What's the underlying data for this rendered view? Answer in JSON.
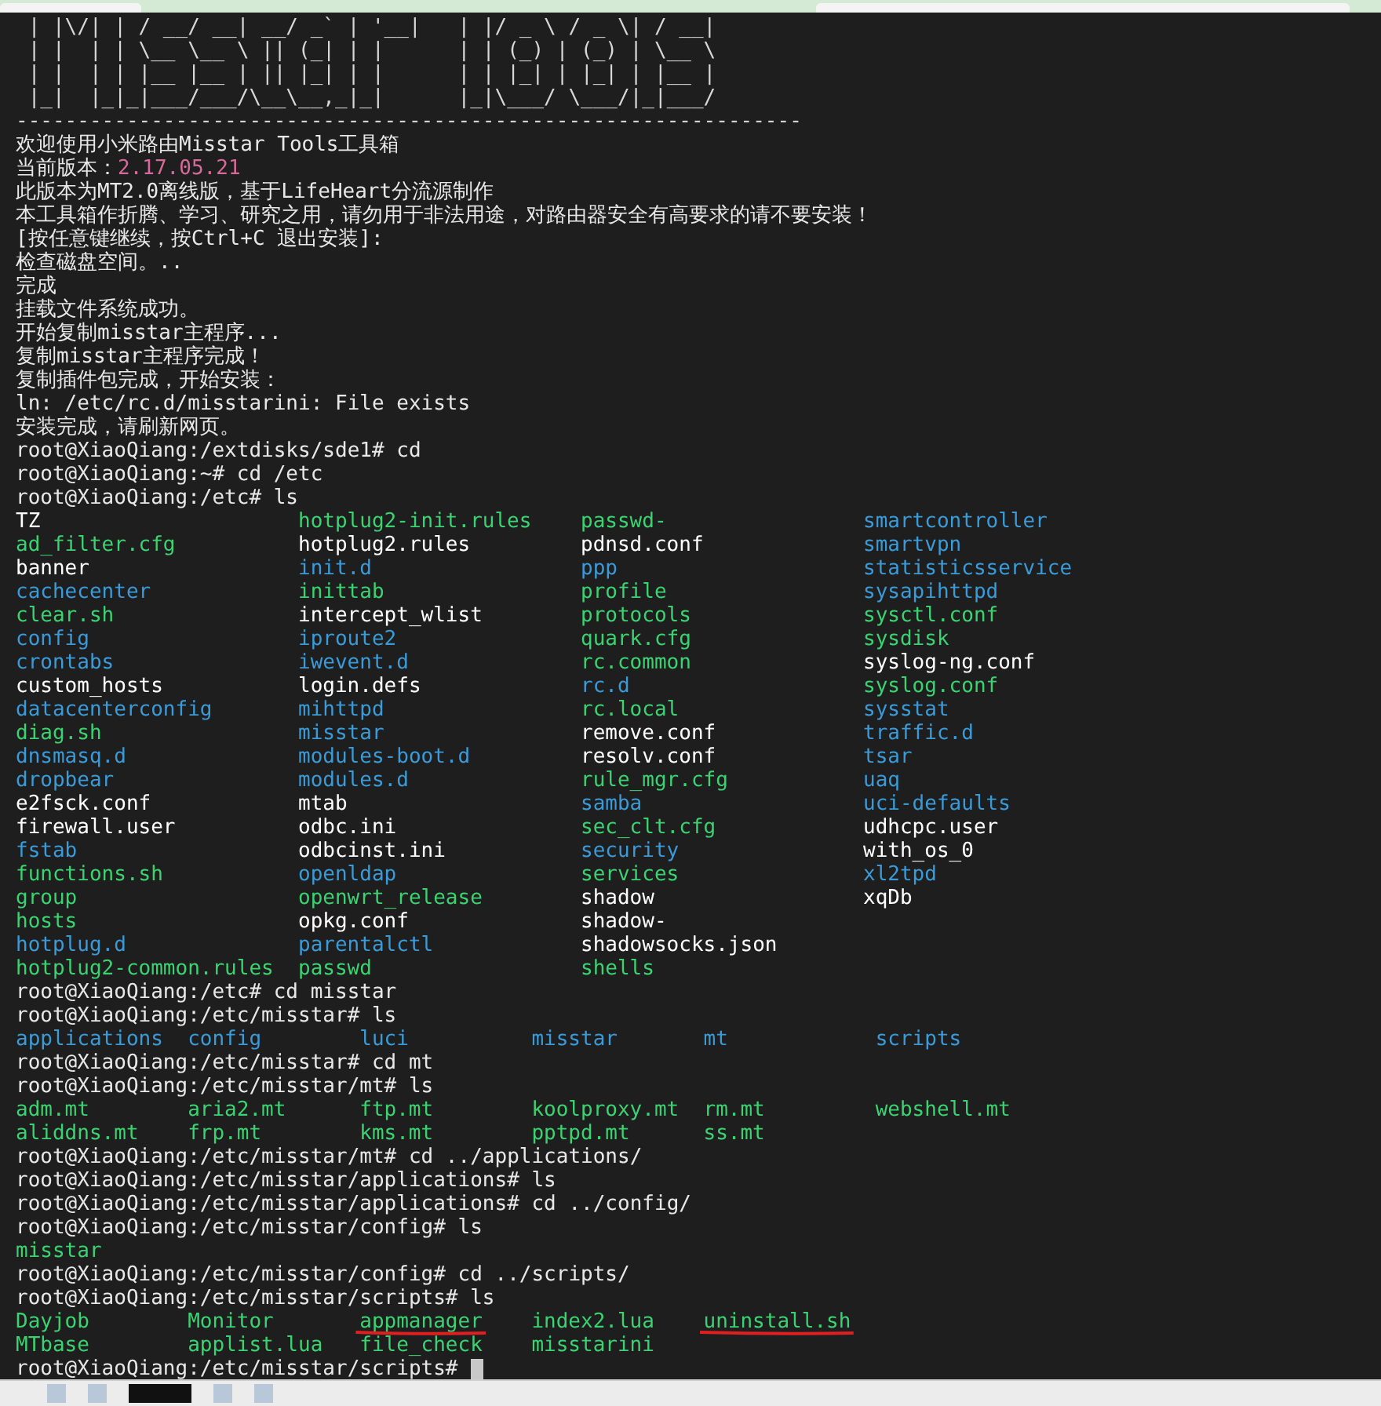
{
  "banner": {
    "art": [
      " | |\\/| | / __/ __| __/ _` | '__|   | |/ _ \\ / _ \\| / __|",
      " | |  | | \\__ \\__ \\ || (_| | |      | | (_) | (_) | \\__ \\",
      " | |  | | |__ |__ | || |_| | |      | | |_| | |_| | |__ |",
      " |_|  |_|_|___/___/\\__\\__,_|_|      |_|\\___/ \\___/|_|___/"
    ],
    "rule": "----------------------------------------------------------------"
  },
  "lines": [
    {
      "kind": "text",
      "text": "欢迎使用小米路由Misstar Tools工具箱"
    },
    {
      "kind": "version",
      "label": "当前版本：",
      "value": "2.17.05.21",
      "color": "#d66a9a"
    },
    {
      "kind": "text",
      "text": "此版本为MT2.0离线版，基于LifeHeart分流源制作"
    },
    {
      "kind": "text",
      "text": "本工具箱作折腾、学习、研究之用，请勿用于非法用途，对路由器安全有高要求的请不要安装！"
    },
    {
      "kind": "text",
      "text": "[按任意键继续，按Ctrl+C 退出安装]:"
    },
    {
      "kind": "text",
      "text": "检查磁盘空间。.."
    },
    {
      "kind": "text",
      "text": "完成"
    },
    {
      "kind": "text",
      "text": "挂载文件系统成功。"
    },
    {
      "kind": "text",
      "text": "开始复制misstar主程序..."
    },
    {
      "kind": "text",
      "text": "复制misstar主程序完成！"
    },
    {
      "kind": "text",
      "text": "复制插件包完成，开始安装："
    },
    {
      "kind": "text",
      "text": "ln: /etc/rc.d/misstarini: File exists"
    },
    {
      "kind": "text",
      "text": "安装完成，请刷新网页。"
    },
    {
      "kind": "text",
      "text": "root@XiaoQiang:/extdisks/sde1# cd"
    },
    {
      "kind": "text",
      "text": "root@XiaoQiang:~# cd /etc"
    },
    {
      "kind": "text",
      "text": "root@XiaoQiang:/etc# ls"
    },
    {
      "kind": "listing",
      "rows": [
        [
          {
            "name": "TZ",
            "color": "#ffffff"
          },
          {
            "name": "hotplug2-init.rules",
            "color": "#3bd371"
          },
          {
            "name": "passwd-",
            "color": "#3bd371"
          },
          {
            "name": "smartcontroller",
            "color": "#3a9bd8"
          }
        ],
        [
          {
            "name": "ad_filter.cfg",
            "color": "#3bd371"
          },
          {
            "name": "hotplug2.rules",
            "color": "#ffffff"
          },
          {
            "name": "pdnsd.conf",
            "color": "#ffffff"
          },
          {
            "name": "smartvpn",
            "color": "#3a9bd8"
          }
        ],
        [
          {
            "name": "banner",
            "color": "#ffffff"
          },
          {
            "name": "init.d",
            "color": "#3a9bd8"
          },
          {
            "name": "ppp",
            "color": "#3a9bd8"
          },
          {
            "name": "statisticsservice",
            "color": "#3a9bd8"
          }
        ],
        [
          {
            "name": "cachecenter",
            "color": "#3a9bd8"
          },
          {
            "name": "inittab",
            "color": "#3bd371"
          },
          {
            "name": "profile",
            "color": "#3bd371"
          },
          {
            "name": "sysapihttpd",
            "color": "#3a9bd8"
          }
        ],
        [
          {
            "name": "clear.sh",
            "color": "#3bd371"
          },
          {
            "name": "intercept_wlist",
            "color": "#ffffff"
          },
          {
            "name": "protocols",
            "color": "#3bd371"
          },
          {
            "name": "sysctl.conf",
            "color": "#3bd371"
          }
        ],
        [
          {
            "name": "config",
            "color": "#3a9bd8"
          },
          {
            "name": "iproute2",
            "color": "#3a9bd8"
          },
          {
            "name": "quark.cfg",
            "color": "#3bd371"
          },
          {
            "name": "sysdisk",
            "color": "#3bd371"
          }
        ],
        [
          {
            "name": "crontabs",
            "color": "#3a9bd8"
          },
          {
            "name": "iwevent.d",
            "color": "#3a9bd8"
          },
          {
            "name": "rc.common",
            "color": "#3bd371"
          },
          {
            "name": "syslog-ng.conf",
            "color": "#ffffff"
          }
        ],
        [
          {
            "name": "custom_hosts",
            "color": "#ffffff"
          },
          {
            "name": "login.defs",
            "color": "#ffffff"
          },
          {
            "name": "rc.d",
            "color": "#3a9bd8"
          },
          {
            "name": "syslog.conf",
            "color": "#3bd371"
          }
        ],
        [
          {
            "name": "datacenterconfig",
            "color": "#3a9bd8"
          },
          {
            "name": "mihttpd",
            "color": "#3a9bd8"
          },
          {
            "name": "rc.local",
            "color": "#3bd371"
          },
          {
            "name": "sysstat",
            "color": "#3a9bd8"
          }
        ],
        [
          {
            "name": "diag.sh",
            "color": "#3bd371"
          },
          {
            "name": "misstar",
            "color": "#3a9bd8"
          },
          {
            "name": "remove.conf",
            "color": "#ffffff"
          },
          {
            "name": "traffic.d",
            "color": "#3a9bd8"
          }
        ],
        [
          {
            "name": "dnsmasq.d",
            "color": "#3a9bd8"
          },
          {
            "name": "modules-boot.d",
            "color": "#3a9bd8"
          },
          {
            "name": "resolv.conf",
            "color": "#ffffff"
          },
          {
            "name": "tsar",
            "color": "#3a9bd8"
          }
        ],
        [
          {
            "name": "dropbear",
            "color": "#3a9bd8"
          },
          {
            "name": "modules.d",
            "color": "#3a9bd8"
          },
          {
            "name": "rule_mgr.cfg",
            "color": "#3bd371"
          },
          {
            "name": "uaq",
            "color": "#3a9bd8"
          }
        ],
        [
          {
            "name": "e2fsck.conf",
            "color": "#ffffff"
          },
          {
            "name": "mtab",
            "color": "#ffffff"
          },
          {
            "name": "samba",
            "color": "#3a9bd8"
          },
          {
            "name": "uci-defaults",
            "color": "#3a9bd8"
          }
        ],
        [
          {
            "name": "firewall.user",
            "color": "#ffffff"
          },
          {
            "name": "odbc.ini",
            "color": "#ffffff"
          },
          {
            "name": "sec_clt.cfg",
            "color": "#3bd371"
          },
          {
            "name": "udhcpc.user",
            "color": "#ffffff"
          }
        ],
        [
          {
            "name": "fstab",
            "color": "#3a9bd8"
          },
          {
            "name": "odbcinst.ini",
            "color": "#ffffff"
          },
          {
            "name": "security",
            "color": "#3a9bd8"
          },
          {
            "name": "with_os_0",
            "color": "#ffffff"
          }
        ],
        [
          {
            "name": "functions.sh",
            "color": "#3bd371"
          },
          {
            "name": "openldap",
            "color": "#3a9bd8"
          },
          {
            "name": "services",
            "color": "#3bd371"
          },
          {
            "name": "xl2tpd",
            "color": "#3a9bd8"
          }
        ],
        [
          {
            "name": "group",
            "color": "#3bd371"
          },
          {
            "name": "openwrt_release",
            "color": "#3bd371"
          },
          {
            "name": "shadow",
            "color": "#ffffff"
          },
          {
            "name": "xqDb",
            "color": "#ffffff"
          }
        ],
        [
          {
            "name": "hosts",
            "color": "#3bd371"
          },
          {
            "name": "opkg.conf",
            "color": "#ffffff"
          },
          {
            "name": "shadow-",
            "color": "#ffffff"
          }
        ],
        [
          {
            "name": "hotplug.d",
            "color": "#3a9bd8"
          },
          {
            "name": "parentalctl",
            "color": "#3a9bd8"
          },
          {
            "name": "shadowsocks.json",
            "color": "#ffffff"
          }
        ],
        [
          {
            "name": "hotplug2-common.rules",
            "color": "#3bd371"
          },
          {
            "name": "passwd",
            "color": "#3bd371"
          },
          {
            "name": "shells",
            "color": "#3bd371"
          }
        ]
      ]
    },
    {
      "kind": "text",
      "text": "root@XiaoQiang:/etc# cd misstar"
    },
    {
      "kind": "text",
      "text": "root@XiaoQiang:/etc/misstar# ls"
    },
    {
      "kind": "listing",
      "rows": [
        [
          {
            "name": "applications",
            "color": "#3a9bd8"
          },
          {
            "name": "config",
            "color": "#3a9bd8"
          },
          {
            "name": "luci",
            "color": "#3a9bd8"
          },
          {
            "name": "misstar",
            "color": "#3a9bd8"
          },
          {
            "name": "mt",
            "color": "#3a9bd8"
          },
          {
            "name": "scripts",
            "color": "#3a9bd8"
          }
        ]
      ]
    },
    {
      "kind": "text",
      "text": "root@XiaoQiang:/etc/misstar# cd mt"
    },
    {
      "kind": "text",
      "text": "root@XiaoQiang:/etc/misstar/mt# ls"
    },
    {
      "kind": "listing",
      "rows": [
        [
          {
            "name": "adm.mt",
            "color": "#3bd371"
          },
          {
            "name": "aria2.mt",
            "color": "#3bd371"
          },
          {
            "name": "ftp.mt",
            "color": "#3bd371"
          },
          {
            "name": "koolproxy.mt",
            "color": "#3bd371"
          },
          {
            "name": "rm.mt",
            "color": "#3bd371"
          },
          {
            "name": "webshell.mt",
            "color": "#3bd371"
          }
        ],
        [
          {
            "name": "aliddns.mt",
            "color": "#3bd371"
          },
          {
            "name": "frp.mt",
            "color": "#3bd371"
          },
          {
            "name": "kms.mt",
            "color": "#3bd371"
          },
          {
            "name": "pptpd.mt",
            "color": "#3bd371"
          },
          {
            "name": "ss.mt",
            "color": "#3bd371"
          }
        ]
      ]
    },
    {
      "kind": "text",
      "text": "root@XiaoQiang:/etc/misstar/mt# cd ../applications/"
    },
    {
      "kind": "text",
      "text": "root@XiaoQiang:/etc/misstar/applications# ls"
    },
    {
      "kind": "text",
      "text": "root@XiaoQiang:/etc/misstar/applications# cd ../config/"
    },
    {
      "kind": "text",
      "text": "root@XiaoQiang:/etc/misstar/config# ls"
    },
    {
      "kind": "listing",
      "rows": [
        [
          {
            "name": "misstar",
            "color": "#3bd371"
          }
        ]
      ]
    },
    {
      "kind": "text",
      "text": "root@XiaoQiang:/etc/misstar/config# cd ../scripts/"
    },
    {
      "kind": "text",
      "text": "root@XiaoQiang:/etc/misstar/scripts# ls"
    },
    {
      "kind": "listing",
      "rows": [
        [
          {
            "name": "Dayjob",
            "color": "#3bd371",
            "underlined": false
          },
          {
            "name": "Monitor",
            "color": "#3bd371",
            "underlined": false
          },
          {
            "name": "appmanager",
            "color": "#3bd371",
            "underlined": true
          },
          {
            "name": "index2.lua",
            "color": "#3bd371",
            "underlined": false
          },
          {
            "name": "uninstall.sh",
            "color": "#3bd371",
            "underlined": true
          }
        ],
        [
          {
            "name": "MTbase",
            "color": "#3bd371",
            "underlined": false
          },
          {
            "name": "applist.lua",
            "color": "#3bd371",
            "underlined": false
          },
          {
            "name": "file_check",
            "color": "#3bd371",
            "underlined": false
          },
          {
            "name": "misstarini",
            "color": "#3bd371",
            "underlined": false
          }
        ]
      ]
    },
    {
      "kind": "prompt",
      "text": "root@XiaoQiang:/etc/misstar/scripts# "
    }
  ]
}
